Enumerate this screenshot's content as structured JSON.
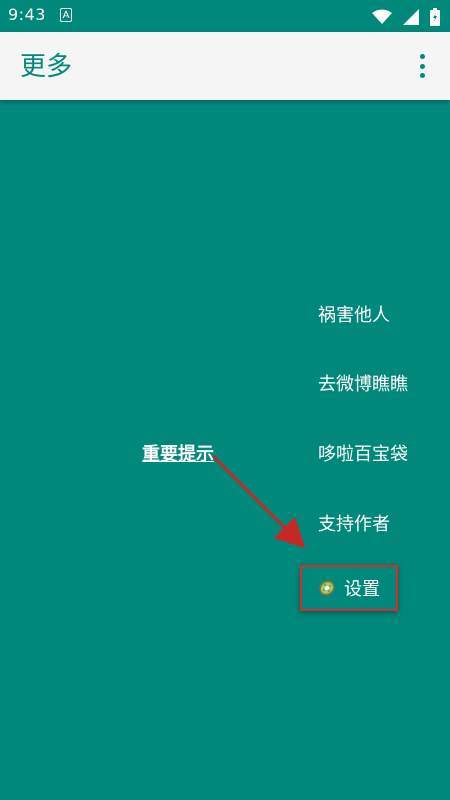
{
  "status_bar": {
    "time": "9:43",
    "notification_icon": "a-icon"
  },
  "app_bar": {
    "title": "更多",
    "overflow_icon": "more-vert-icon"
  },
  "menu": {
    "items": [
      {
        "label": "祸害他人"
      },
      {
        "label": "去微博瞧瞧"
      },
      {
        "label": "哆啦百宝袋"
      },
      {
        "label": "支持作者"
      }
    ],
    "settings": {
      "label": "设置",
      "icon": "kiwi-icon"
    }
  },
  "notice": {
    "label": "重要提示"
  },
  "colors": {
    "primary": "#00897B",
    "app_bar_bg": "#F5F5F5",
    "highlight_border": "#D32F2F",
    "arrow": "#C62828"
  }
}
